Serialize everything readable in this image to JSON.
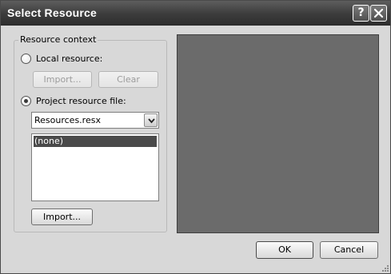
{
  "window": {
    "title": "Select Resource",
    "help_glyph": "?",
    "close_icon": "close-icon"
  },
  "resource_context": {
    "group_label": "Resource context",
    "local_resource": {
      "label": "Local resource:",
      "selected": false
    },
    "local_import_label": "Import...",
    "local_clear_label": "Clear",
    "project_resource": {
      "label": "Project resource file:",
      "selected": true
    },
    "resource_file": {
      "selected_value": "Resources.resx"
    },
    "resource_list": [
      "(none)"
    ],
    "selected_item": "(none)",
    "import_label": "Import..."
  },
  "footer": {
    "ok_label": "OK",
    "cancel_label": "Cancel"
  },
  "colors": {
    "titlebar": "#3c3c3c",
    "dialog_bg": "#d8d8d8",
    "preview_bg": "#6b6b6b",
    "selection": "#4a4a4a"
  }
}
